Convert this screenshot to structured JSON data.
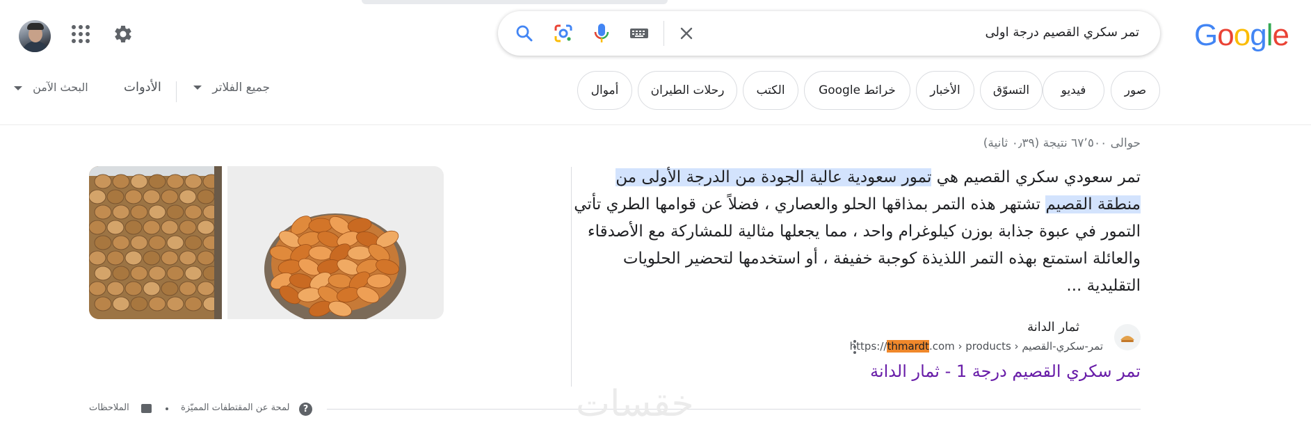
{
  "logo": {
    "text": "Google",
    "colors": [
      "#4285f4",
      "#ea4335",
      "#fbbc05",
      "#4285f4",
      "#34a853",
      "#ea4335"
    ]
  },
  "search": {
    "query": "تمر سكري القصيم درجة اولى"
  },
  "icons": {
    "clear": "close-icon",
    "keyboard": "keyboard-icon",
    "voice": "mic-icon",
    "lens": "lens-icon",
    "search": "search-icon",
    "apps": "apps-grid-icon",
    "settings": "gear-icon"
  },
  "chips": [
    "صور",
    "فيديو",
    "التسوّق",
    "الأخبار",
    "خرائط Google",
    "الكتب",
    "رحلات الطيران",
    "أموال"
  ],
  "filters": {
    "all_filters": "جميع الفلاتر",
    "tools": "الأدوات",
    "safe_search": "البحث الآمن"
  },
  "results_count": "حوالى ٦٧٬٥٠٠ نتيجة (٠٫٣٩ ثانية)",
  "snippet": {
    "part1": "تمر سعودي سكري القصيم هي ",
    "highlight1": "تمور سعودية عالية الجودة من الدرجة الأولى من منطقة القصيم",
    "part2": " تشتهر هذه التمر بمذاقها الحلو والعصاري ، فضلاً عن قوامها الطري تأتي التمور في عبوة جذابة بوزن كيلوغرام واحد ، مما يجعلها مثالية للمشاركة مع الأصدقاء والعائلة استمتع بهذه التمر اللذيذة كوجبة خفيفة ، أو استخدمها لتحضير الحلويات التقليدية ..."
  },
  "result": {
    "site_name": "ثمار الدانة",
    "url_prefix": "https://",
    "url_highlight": "thmardt",
    "url_rest": ".com › products › تمر-سكري-القصيم",
    "title": "تمر سكري القصيم درجة 1 - ثمار الدانة"
  },
  "footer": {
    "about": "لمحة عن المقتطفات المميّزة",
    "feedback": "الملاحظات"
  },
  "watermark": "خقسات"
}
